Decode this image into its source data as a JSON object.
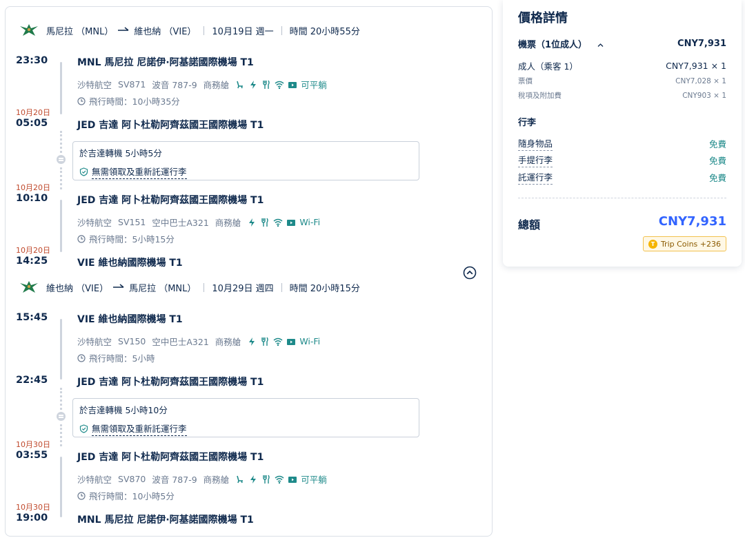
{
  "outbound": {
    "header": {
      "from": "馬尼拉 （MNL）",
      "to": "維也納 （VIE）",
      "date": "10月19日 週一",
      "total_time": "時間 20小時55分"
    },
    "seg1": {
      "dep_time": "23:30",
      "dep_airport": "MNL 馬尼拉 尼諾伊·阿基諾國際機場 T1",
      "airline": "沙特航空",
      "flight": "SV871",
      "aircraft": "波音 787-9",
      "cabin": "商務艙",
      "amenity_text": "可平躺",
      "duration": "飛行時間：10小時35分",
      "arr_note": "10月20日",
      "arr_time": "05:05",
      "arr_airport": "JED 吉達 阿卜杜勒阿齊茲國王國際機場 T1"
    },
    "transfer": {
      "title": "於吉達轉機   5小時5分",
      "baggage": "無需領取及重新託運行李"
    },
    "seg2": {
      "dep_note": "10月20日",
      "dep_time": "10:10",
      "dep_airport": "JED 吉達 阿卜杜勒阿齊茲國王國際機場 T1",
      "airline": "沙特航空",
      "flight": "SV151",
      "aircraft": "空中巴士A321",
      "cabin": "商務艙",
      "amenity_text": "Wi-Fi",
      "duration": "飛行時間：5小時15分",
      "arr_note": "10月20日",
      "arr_time": "14:25",
      "arr_airport": "VIE 維也納國際機場 T1"
    }
  },
  "inbound": {
    "header": {
      "from": "維也納 （VIE）",
      "to": "馬尼拉 （MNL）",
      "date": "10月29日 週四",
      "total_time": "時間 20小時15分"
    },
    "seg1": {
      "dep_time": "15:45",
      "dep_airport": "VIE 維也納國際機場 T1",
      "airline": "沙特航空",
      "flight": "SV150",
      "aircraft": "空中巴士A321",
      "cabin": "商務艙",
      "amenity_text": "Wi-Fi",
      "duration": "飛行時間：5小時",
      "arr_time": "22:45",
      "arr_airport": "JED 吉達 阿卜杜勒阿齊茲國王國際機場 T1"
    },
    "transfer": {
      "title": "於吉達轉機   5小時10分",
      "baggage": "無需領取及重新託運行李"
    },
    "seg2": {
      "dep_note": "10月30日",
      "dep_time": "03:55",
      "dep_airport": "JED 吉達 阿卜杜勒阿齊茲國王國際機場 T1",
      "airline": "沙特航空",
      "flight": "SV870",
      "aircraft": "波音 787-9",
      "cabin": "商務艙",
      "amenity_text": "可平躺",
      "duration": "飛行時間：10小時5分",
      "arr_note": "10月30日",
      "arr_time": "19:00",
      "arr_airport": "MNL 馬尼拉 尼諾伊·阿基諾國際機場 T1"
    }
  },
  "icons": {
    "airline_logo": "saudia-logo-icon",
    "arrow": "arrow-right-icon",
    "clock": "clock-icon",
    "seat": "seat-icon",
    "power": "power-icon",
    "meal": "meal-icon",
    "wifi": "wifi-icon",
    "entertainment": "entertainment-icon",
    "shield": "shield-check-icon",
    "collapse": "chevron-up-circle-icon"
  },
  "price": {
    "title": "價格詳情",
    "ticket_label": "機票（1位成人）",
    "ticket_total": "CNY7,931",
    "adult_label": "成人（乘客 1）",
    "adult_value": "CNY7,931 × 1",
    "fare_label": "票價",
    "fare_value": "CNY7,028 × 1",
    "tax_label": "稅項及附加費",
    "tax_value": "CNY903 × 1",
    "baggage_title": "行李",
    "personal_item": "隨身物品",
    "personal_value": "免費",
    "carry_on": "手提行李",
    "carry_on_value": "免費",
    "checked": "託運行李",
    "checked_value": "免費",
    "total_label": "總額",
    "total_value": "CNY7,931",
    "coins": "Trip Coins +236",
    "coin_letter": "T"
  },
  "colors": {
    "text": "#0f294d",
    "muted": "#6b7a90",
    "accent_blue": "#3264ff",
    "amenity_teal": "#1e8a8a",
    "date_note": "#c0492c",
    "logo_green": "#1f7a4a"
  }
}
